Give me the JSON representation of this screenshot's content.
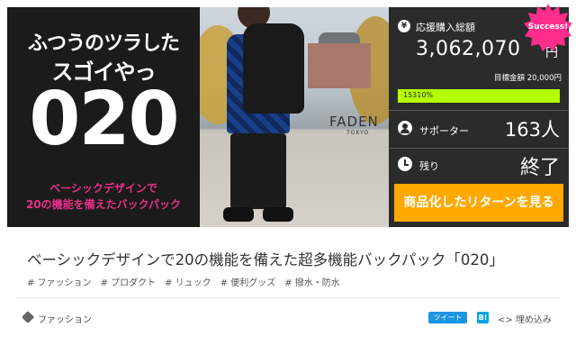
{
  "hero": {
    "tagline_line1": "ふつうのツラした",
    "tagline_line2": "スゴイやっ",
    "number": "020",
    "sub_line1": "ベーシックデザインで",
    "sub_line2": "20の機能を備えたバックパック",
    "sub_color": "#e8308a"
  },
  "photo": {
    "brand": "FADEN",
    "brand_sub": "TOKYO"
  },
  "info": {
    "success_badge": "Success!",
    "badge_color": "#ff2e8b",
    "yen_icon": "¥",
    "funding_label": "応援購入総額",
    "funding_amount": "3,062,070",
    "funding_unit": "円",
    "goal": "目標金額 20,000円",
    "progress_text": "15310%",
    "progress_color": "#b4ff00",
    "supporters_label": "サポーター",
    "supporters_value": "163人",
    "remaining_label": "残り",
    "remaining_value": "終了",
    "cta_label": "商品化したリターンを見る",
    "cta_color": "#ffa800"
  },
  "project": {
    "title": "ベーシックデザインで20の機能を備えた超多機能バックパック「020」",
    "tags": [
      "# ファッション",
      "# プロダクト",
      "# リュック",
      "# 便利グッズ",
      "# 撥水・防水"
    ],
    "category": "ファッション",
    "tweet_label": "ツイート",
    "hatena_label": "B!",
    "embed_label": "<> 埋め込み"
  }
}
